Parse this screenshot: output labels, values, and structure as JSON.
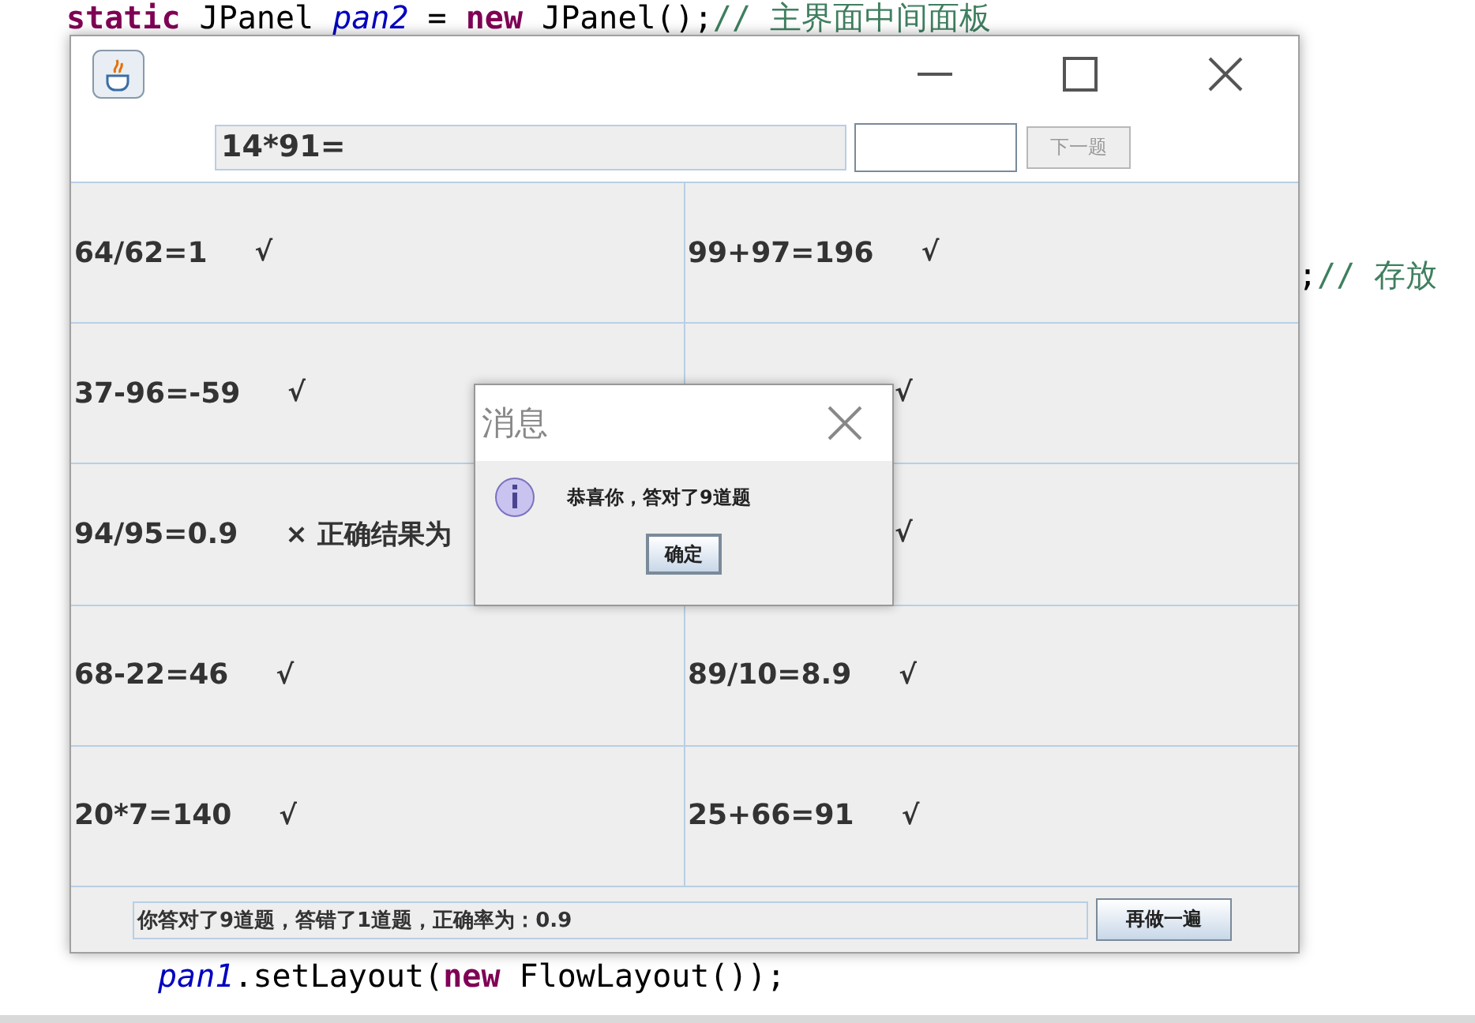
{
  "editor": {
    "lines": [
      {
        "tokens": [
          {
            "kind": "keyword",
            "text": "static"
          },
          {
            "kind": "plain",
            "text": " JPanel "
          },
          {
            "kind": "field",
            "text": "pan2"
          },
          {
            "kind": "plain",
            "text": " = "
          },
          {
            "kind": "keyword",
            "text": "new"
          },
          {
            "kind": "plain",
            "text": " JPanel();"
          },
          {
            "kind": "comment",
            "text": "// 主界面中间面板"
          }
        ]
      },
      {
        "tokens": [
          {
            "kind": "plain",
            "text": ";"
          },
          {
            "kind": "comment",
            "text": "// 存放"
          }
        ]
      },
      {
        "tokens": [
          {
            "kind": "field",
            "text": "pan1"
          },
          {
            "kind": "plain",
            "text": ".setLayout("
          },
          {
            "kind": "keyword",
            "text": "new"
          },
          {
            "kind": "plain",
            "text": " FlowLayout());"
          }
        ]
      }
    ]
  },
  "window": {
    "question": "14*91=",
    "next_button": {
      "label": "下一题",
      "disabled": true
    },
    "cells": [
      {
        "kind": "full",
        "expression": "64/62=1",
        "mark": "√"
      },
      {
        "kind": "full",
        "expression": "99+97=196",
        "mark": "√"
      },
      {
        "kind": "full",
        "expression": "37-96=-59",
        "mark": "√"
      },
      {
        "kind": "covered",
        "mark": "√"
      },
      {
        "kind": "full",
        "expression": "94/95=0.9",
        "mark": "× 正确结果为"
      },
      {
        "kind": "covered",
        "mark": "√"
      },
      {
        "kind": "full",
        "expression": "68-22=46",
        "mark": "√"
      },
      {
        "kind": "full",
        "expression": "89/10=8.9",
        "mark": "√"
      },
      {
        "kind": "full",
        "expression": "20*7=140",
        "mark": "√"
      },
      {
        "kind": "full",
        "expression": "25+66=91",
        "mark": "√"
      }
    ],
    "summary": "你答对了9道题，答错了1道题，正确率为：0.9",
    "redo_button": "再做一遍"
  },
  "dialog": {
    "title": "消息",
    "message": "恭喜你，答对了9道题",
    "ok_button": "确定"
  }
}
